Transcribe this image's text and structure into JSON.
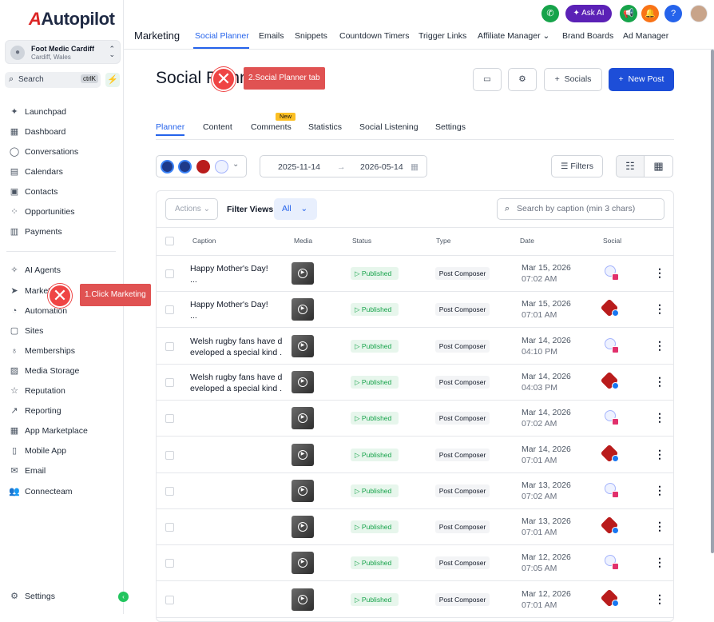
{
  "brand": {
    "name": "Autopilot"
  },
  "location": {
    "name": "Foot Medic Cardiff",
    "city": "Cardiff, Wales"
  },
  "search": {
    "label": "Search",
    "shortcut": "ctrlK"
  },
  "sidebar": {
    "items": [
      {
        "label": "Launchpad",
        "icon": "rocket-icon"
      },
      {
        "label": "Dashboard",
        "icon": "grid-icon"
      },
      {
        "label": "Conversations",
        "icon": "chat-icon"
      },
      {
        "label": "Calendars",
        "icon": "calendar-icon"
      },
      {
        "label": "Contacts",
        "icon": "contacts-icon"
      },
      {
        "label": "Opportunities",
        "icon": "opportunities-icon"
      },
      {
        "label": "Payments",
        "icon": "payments-icon"
      },
      {
        "label": "AI Agents",
        "icon": "sparkle-icon"
      },
      {
        "label": "Marketing",
        "icon": "send-icon"
      },
      {
        "label": "Automation",
        "icon": "automation-icon"
      },
      {
        "label": "Sites",
        "icon": "sites-icon"
      },
      {
        "label": "Memberships",
        "icon": "memberships-icon"
      },
      {
        "label": "Media Storage",
        "icon": "image-icon"
      },
      {
        "label": "Reputation",
        "icon": "star-icon"
      },
      {
        "label": "Reporting",
        "icon": "trend-icon"
      },
      {
        "label": "App Marketplace",
        "icon": "apps-icon"
      },
      {
        "label": "Mobile App",
        "icon": "mobile-icon"
      },
      {
        "label": "Email",
        "icon": "email-icon"
      },
      {
        "label": "Connecteam",
        "icon": "team-icon"
      }
    ],
    "settings_label": "Settings"
  },
  "topbar": {
    "section": "Marketing",
    "tabs": [
      "Social Planner",
      "Emails",
      "Snippets",
      "Countdown Timers",
      "Trigger Links",
      "Affiliate Manager",
      "Brand Boards",
      "Ad Manager"
    ],
    "ask_ai": "Ask AI"
  },
  "page": {
    "title": "Social Planner",
    "socials_button": "Socials",
    "new_post_button": "New Post"
  },
  "subtabs": [
    "Planner",
    "Content",
    "Comments",
    "Statistics",
    "Social Listening",
    "Settings"
  ],
  "new_badge": "New",
  "filters": {
    "start_date": "2025-11-14",
    "end_date": "2026-05-14",
    "filters_label": "Filters",
    "actions_label": "Actions",
    "filter_views_label": "Filter Views:",
    "filter_view_value": "All",
    "search_placeholder": "Search by caption (min 3 chars)"
  },
  "table": {
    "columns": [
      "Caption",
      "Media",
      "Status",
      "Type",
      "Date",
      "Social"
    ],
    "rows": [
      {
        "caption": "Happy Mother's Day!\n...",
        "status": "Published",
        "type": "Post Composer",
        "date": "Mar 15, 2026",
        "time": "07:02 AM",
        "social": "instagram"
      },
      {
        "caption": "Happy Mother's Day!\n...",
        "status": "Published",
        "type": "Post Composer",
        "date": "Mar 15, 2026",
        "time": "07:01 AM",
        "social": "facebook"
      },
      {
        "caption": "Welsh rugby fans have d\neveloped a special kind ...",
        "status": "Published",
        "type": "Post Composer",
        "date": "Mar 14, 2026",
        "time": "04:10 PM",
        "social": "instagram"
      },
      {
        "caption": "Welsh rugby fans have d\neveloped a special kind ...",
        "status": "Published",
        "type": "Post Composer",
        "date": "Mar 14, 2026",
        "time": "04:03 PM",
        "social": "facebook"
      },
      {
        "caption": "",
        "status": "Published",
        "type": "Post Composer",
        "date": "Mar 14, 2026",
        "time": "07:02 AM",
        "social": "instagram"
      },
      {
        "caption": "",
        "status": "Published",
        "type": "Post Composer",
        "date": "Mar 14, 2026",
        "time": "07:01 AM",
        "social": "facebook"
      },
      {
        "caption": "",
        "status": "Published",
        "type": "Post Composer",
        "date": "Mar 13, 2026",
        "time": "07:02 AM",
        "social": "instagram"
      },
      {
        "caption": "",
        "status": "Published",
        "type": "Post Composer",
        "date": "Mar 13, 2026",
        "time": "07:01 AM",
        "social": "facebook"
      },
      {
        "caption": "",
        "status": "Published",
        "type": "Post Composer",
        "date": "Mar 12, 2026",
        "time": "07:05 AM",
        "social": "instagram"
      },
      {
        "caption": "",
        "status": "Published",
        "type": "Post Composer",
        "date": "Mar 12, 2026",
        "time": "07:01 AM",
        "social": "facebook"
      }
    ]
  },
  "annotations": {
    "step1": "1.Click Marketing",
    "step2": "2.Social Planner tab"
  },
  "colors": {
    "accent": "#2563eb",
    "published": "#16a34a",
    "marker": "#ef4444"
  }
}
